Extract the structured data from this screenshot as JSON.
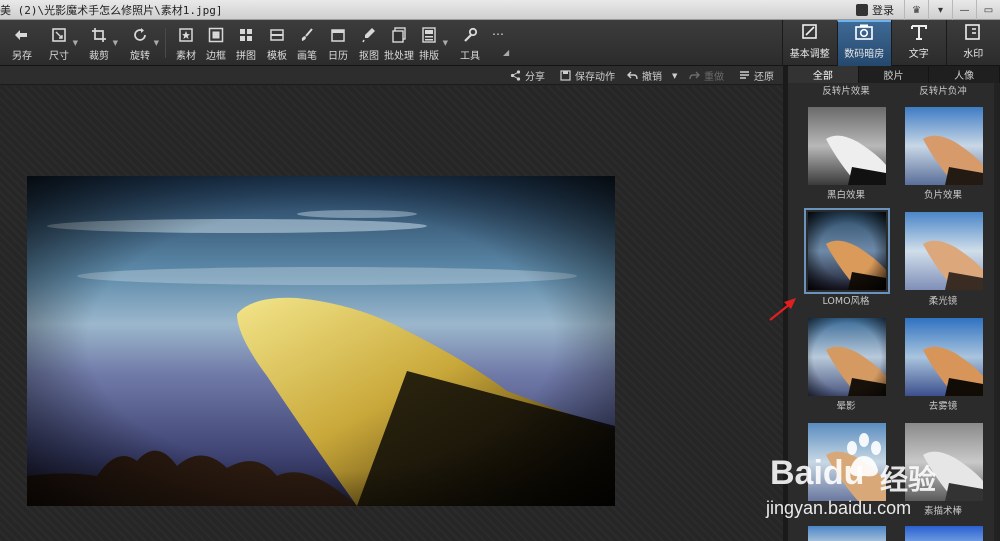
{
  "titlebar": {
    "title": "美 (2)\\光影魔术手怎么修照片\\素材1.jpg]",
    "login_label": "登录"
  },
  "toolbar": {
    "items": [
      {
        "label": "另存",
        "icon": "save-as-icon"
      },
      {
        "label": "尺寸",
        "icon": "resize-icon"
      },
      {
        "label": "裁剪",
        "icon": "crop-icon"
      },
      {
        "label": "旋转",
        "icon": "rotate-icon"
      },
      {
        "label": "素材",
        "icon": "material-icon"
      },
      {
        "label": "边框",
        "icon": "border-icon"
      },
      {
        "label": "拼图",
        "icon": "collage-icon"
      },
      {
        "label": "模板",
        "icon": "template-icon"
      },
      {
        "label": "画笔",
        "icon": "brush-icon"
      },
      {
        "label": "日历",
        "icon": "calendar-icon"
      },
      {
        "label": "抠图",
        "icon": "cutout-icon"
      },
      {
        "label": "批处理",
        "icon": "batch-icon"
      },
      {
        "label": "排版",
        "icon": "layout-icon"
      },
      {
        "label": "工具",
        "icon": "wrench-icon"
      },
      {
        "label": "…",
        "icon": "more-icon"
      }
    ]
  },
  "modes": [
    {
      "label": "基本调整",
      "icon": "adjust-icon"
    },
    {
      "label": "数码暗房",
      "icon": "darkroom-icon",
      "active": true
    },
    {
      "label": "文字",
      "icon": "text-icon"
    },
    {
      "label": "水印",
      "icon": "watermark-icon"
    }
  ],
  "actions": {
    "share": "分享",
    "save_action": "保存动作",
    "undo": "撤销",
    "redo": "重做",
    "restore": "还原"
  },
  "panel": {
    "tabs": [
      "全部",
      "胶片",
      "人像"
    ],
    "top_captions": [
      "反转片效果",
      "反转片负冲"
    ],
    "effects": [
      {
        "label": "黑白效果"
      },
      {
        "label": "负片效果"
      },
      {
        "label": "LOMO风格",
        "selected": true
      },
      {
        "label": "柔光镜"
      },
      {
        "label": "晕影"
      },
      {
        "label": "去雾镜"
      },
      {
        "label": ""
      },
      {
        "label": "素描术棒"
      }
    ]
  },
  "watermark": {
    "brand": "Baidu",
    "brand_cn": "经验",
    "url": "jingyan.baidu.com"
  },
  "colors": {
    "accent": "#3a6ea0",
    "annotation_arrow": "#e02020"
  }
}
